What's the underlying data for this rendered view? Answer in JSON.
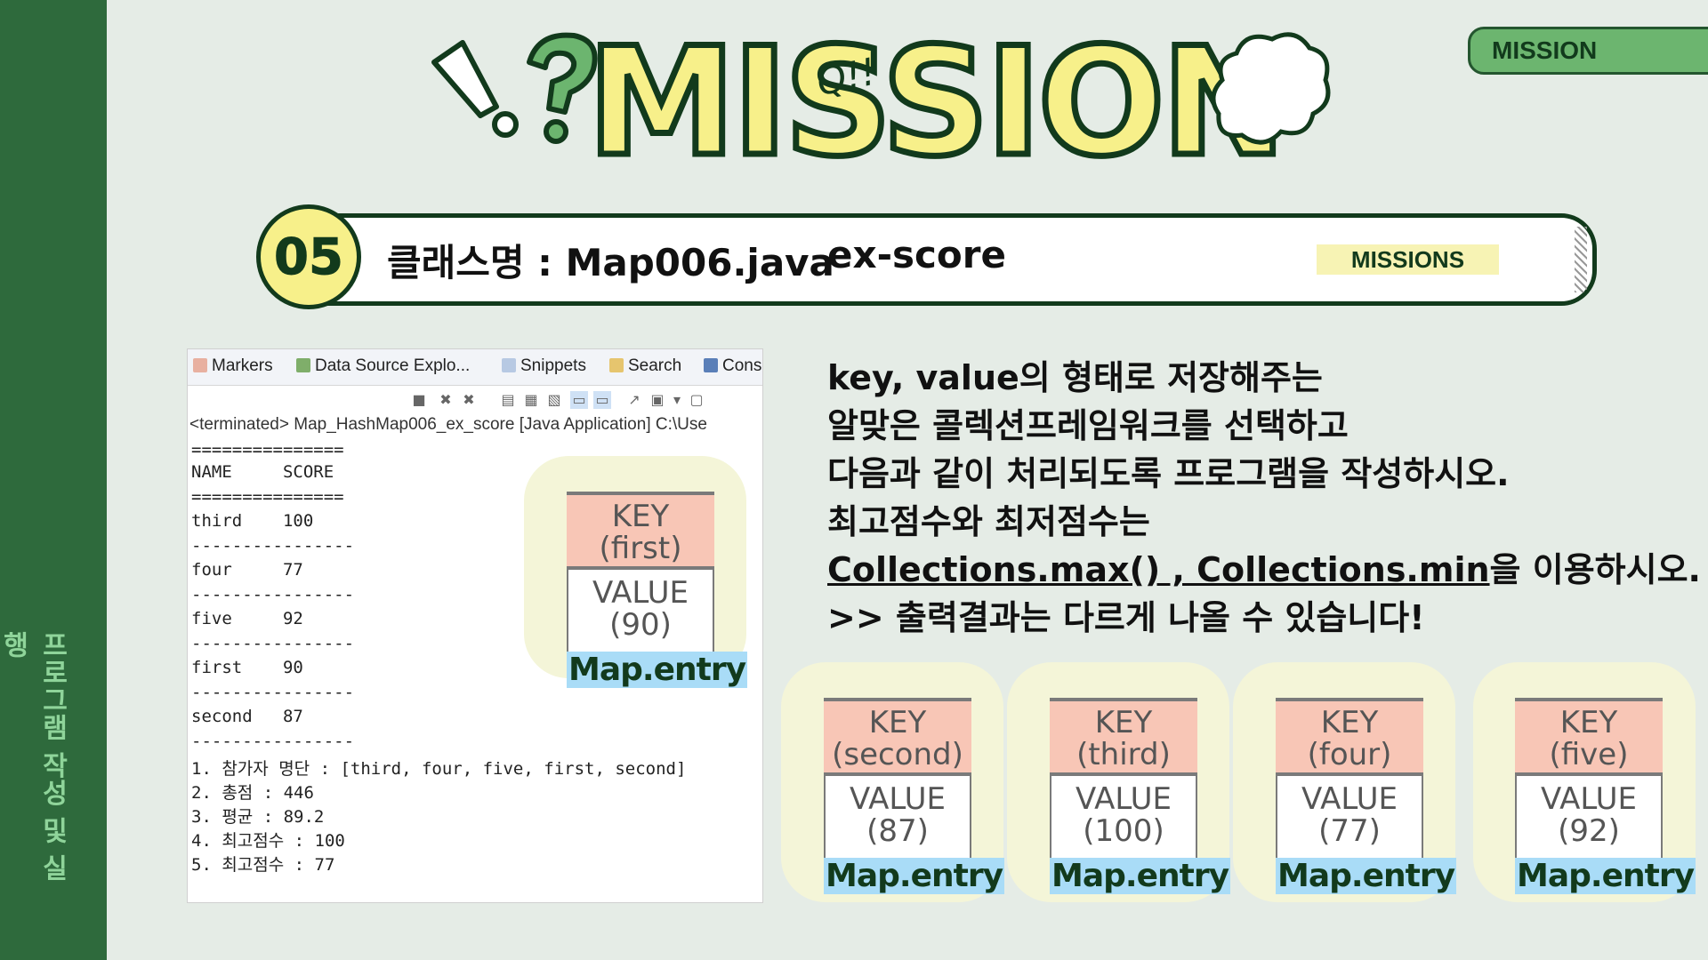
{
  "sidebar": {
    "text": "프로그램 작성 및 실행"
  },
  "header": {
    "title": "MISSION",
    "bubble": "Q!!",
    "tag": "MISSION"
  },
  "banner": {
    "number": "05",
    "class_label": "클래스명 : Map006.java",
    "ex_label": "ex-score",
    "missions_label": "MISSIONS"
  },
  "console": {
    "tabs": [
      "Markers",
      "Data Source Explo...",
      "Snippets",
      "Search",
      "Cons"
    ],
    "terminated": "<terminated> Map_HashMap006_ex_score [Java Application] C:\\Use",
    "lines": [
      "===============",
      "NAME     SCORE",
      "===============",
      "third    100",
      "----------------",
      "four     77",
      "----------------",
      "five     92",
      "----------------",
      "first    90",
      "----------------",
      "second   87",
      "----------------",
      "1. 참가자 명단 : [third, four, five, first, second]",
      "2. 총점 : 446",
      "3. 평균 : 89.2",
      "4. 최고점수 : 100",
      "5. 최고점수 : 77"
    ]
  },
  "instructions": {
    "line1": "key, value의 형태로 저장해주는",
    "line2": "알맞은 콜렉션프레임워크를 선택하고",
    "line3": "다음과 같이 처리되도록 프로그램을 작성하시오.",
    "line4": "최고점수와 최저점수는",
    "line5_link": "Collections.max() , Collections.min",
    "line5_rest": "을 이용하시오.",
    "line6": ">> 출력결과는 다르게 나올 수 있습니다!"
  },
  "entries": [
    {
      "key": "KEY",
      "key_name": "(first)",
      "value": "VALUE",
      "value_num": "(90)",
      "label": "Map.entry"
    },
    {
      "key": "KEY",
      "key_name": "(second)",
      "value": "VALUE",
      "value_num": "(87)",
      "label": "Map.entry"
    },
    {
      "key": "KEY",
      "key_name": "(third)",
      "value": "VALUE",
      "value_num": "(100)",
      "label": "Map.entry"
    },
    {
      "key": "KEY",
      "key_name": "(four)",
      "value": "VALUE",
      "value_num": "(77)",
      "label": "Map.entry"
    },
    {
      "key": "KEY",
      "key_name": "(five)",
      "value": "VALUE",
      "value_num": "(92)",
      "label": "Map.entry"
    }
  ],
  "colors": {
    "sidebar": "#2e6a3c",
    "accent_yellow": "#f7f08a",
    "dark_green": "#123a1c",
    "key_pink": "#f8c6b6",
    "label_blue": "#a9dcf7"
  }
}
